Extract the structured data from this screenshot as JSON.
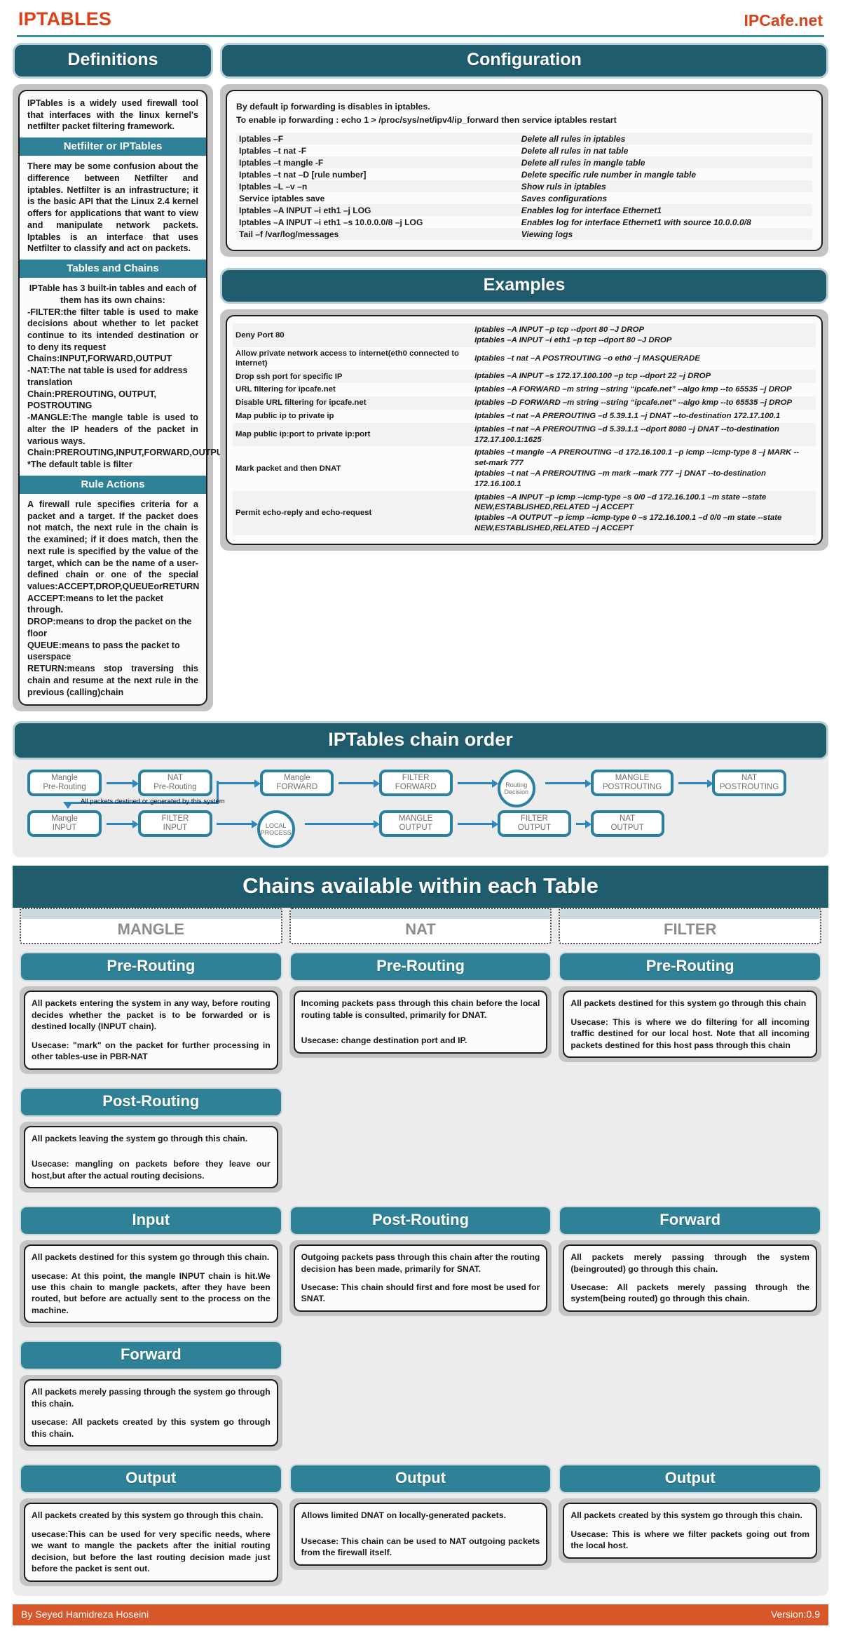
{
  "header": {
    "title": "IPTABLES",
    "site": "IPCafe.net"
  },
  "definitions": {
    "heading": "Definitions",
    "intro": "IPTables is a widely used firewall tool that interfaces with the linux kernel's netfilter packet filtering framework.",
    "netfilter_heading": "Netfilter or IPTables",
    "netfilter_body": "There may be some confusion about the difference between Netfilter and iptables. Netfilter is an infrastructure; it is the basic API that the Linux 2.4 kernel offers for applications that want to view and manipulate network packets. Iptables is an interface that uses Netfilter to classify and act on packets.",
    "tables_heading": "Tables and Chains",
    "tables_intro": "IPTable has 3 built-in tables and each of them has its own chains:",
    "tables_body": "-FILTER:the filter table is used to make decisions about whether to let packet continue to its intended destination or to deny its request",
    "filter_chains": " Chains:INPUT,FORWARD,OUTPUT",
    "nat_body": "-NAT:The nat table is used for address translation",
    "nat_chains": " Chain:PREROUTING, OUTPUT, POSTROUTING",
    "mangle_body": "-MANGLE:The mangle table is used to alter the IP headers of the  packet in various ways.",
    "mangle_chains": "Chain:PREROUTING,INPUT,FORWARD,OUTPUT,POSTROUTING",
    "default_note": "*The default table is filter",
    "rule_actions_heading": "Rule Actions",
    "rule_actions_body": "A firewall rule specifies criteria for a packet and a target. If the packet does not match, the next rule in the chain is the examined; if it does match, then the next rule is specified by the value of the target, which can be the name of a user-defined chain or one of the special values:ACCEPT,DROP,QUEUEorRETURN",
    "accept": "ACCEPT:means to let the packet through.",
    "drop": "DROP:means to drop the packet on the floor",
    "queue": "QUEUE:means to pass the packet to userspace",
    "return": "RETURN:means stop traversing this chain and resume at the next rule in the previous (calling)chain"
  },
  "configuration": {
    "heading": "Configuration",
    "intro_line1": "By default ip forwarding is disables in iptables.",
    "intro_line2": "To enable ip forwarding : echo 1 > /proc/sys/net/ipv4/ip_forward   then service iptables restart",
    "rows": [
      {
        "cmd": "Iptables –F",
        "desc": "Delete all rules in iptables"
      },
      {
        "cmd": "Iptables –t nat -F",
        "desc": "Delete all rules in nat table"
      },
      {
        "cmd": "Iptables –t mangle -F",
        "desc": "Delete all rules in mangle table"
      },
      {
        "cmd": "Iptables –t nat –D [rule number]",
        "desc": "Delete specific rule number in mangle table"
      },
      {
        "cmd": "Iptables –L –v –n",
        "desc": "Show ruls in iptables"
      },
      {
        "cmd": "Service iptables save",
        "desc": "Saves configurations"
      },
      {
        "cmd": "Iptables –A INPUT –i eth1 –j LOG",
        "desc": "Enables log for interface Ethernet1"
      },
      {
        "cmd": "Iptables –A INPUT –i eth1 –s 10.0.0.0/8 –j LOG",
        "desc": "Enables log for interface Ethernet1 with source 10.0.0.0/8"
      },
      {
        "cmd": "Tail –f /var/log/messages",
        "desc": "Viewing logs"
      }
    ]
  },
  "examples": {
    "heading": "Examples",
    "rows": [
      {
        "label": "Deny Port 80",
        "cmd": "Iptables –A INPUT –p tcp --dport 80 –J DROP\nIptables –A INPUT –i eth1 –p tcp --dport 80 –J DROP"
      },
      {
        "label": "Allow private network access to internet(eth0 connected to internet)",
        "cmd": "Iptables –t nat –A POSTROUTING –o eth0 –j MASQUERADE"
      },
      {
        "label": "Drop ssh port for specific IP",
        "cmd": "Iptables –A INPUT –s 172.17.100.100 –p tcp --dport 22 –j DROP"
      },
      {
        "label": "URL filtering for ipcafe.net",
        "cmd": "Iptables –A FORWARD –m string --string “ipcafe.net” --algo kmp --to 65535 –j DROP"
      },
      {
        "label": "Disable URL filtering for ipcafe.net",
        "cmd": "Iptables –D FORWARD –m string --string “ipcafe.net” --algo kmp --to 65535 –j DROP"
      },
      {
        "label": " Map public ip to private ip",
        "cmd": "Iptables –t nat –A PREROUTING –d 5.39.1.1 –j DNAT --to-destination 172.17.100.1"
      },
      {
        "label": "Map public ip:port to private ip:port",
        "cmd": "Iptables –t nat –A PREROUTING –d 5.39.1.1 --dport 8080 –j DNAT --to-destination 172.17.100.1:1625"
      },
      {
        "label": "Mark packet and then DNAT",
        "cmd": "Iptables –t mangle –A PREROUTING –d 172.16.100.1 –p icmp --icmp-type 8 –j MARK --set-mark 777\nIptables –t nat –A PREROUTING –m mark --mark 777 –j DNAT --to-destination 172.16.100.1"
      },
      {
        "label": "Permit echo-reply and echo-request",
        "cmd": "Iptables –A INPUT –p icmp --icmp-type –s 0/0 –d 172.16.100.1 –m state --state NEW,ESTABLISHED,RELATED –j ACCEPT\nIptables –A OUTPUT –p icmp --icmp-type 0 –s 172.16.100.1 –d 0/0 –m state --state NEW,ESTABLISHED,RELATED –j ACCEPT"
      }
    ]
  },
  "chain_order": {
    "title": "IPTables chain order",
    "nodes_top": [
      "Mangle\nPre-Routing",
      "NAT\nPre-Routing",
      "Mangle\nFORWARD",
      "FILTER\nFORWARD",
      "Routing\nDecision",
      "MANGLE\nPOSTROUTING",
      "NAT\nPOSTROUTING"
    ],
    "nodes_bottom": [
      "Mangle\nINPUT",
      "FILTER\nINPUT",
      "LOCAL\nPROCESS",
      "MANGLE\nOUTPUT",
      "FILTER\nOUTPUT",
      "NAT\nOUTPUT"
    ],
    "hook_label": "All packets destined or generated by this system"
  },
  "chains_available": {
    "title": "Chains available within each Table",
    "tables": [
      "MANGLE",
      "NAT",
      "FILTER"
    ],
    "mangle": {
      "prerouting_title": "Pre-Routing",
      "prerouting_body": "All packets entering the system in any way, before routing decides whether the packet is to be forwarded or is destined locally (INPUT chain).",
      "prerouting_usecase": "Usecase: \"mark\" on the packet for further processing in other tables-use in PBR-NAT",
      "postrouting_title": "Post-Routing",
      "postrouting_body": "All packets leaving the system go through this chain.",
      "postrouting_usecase": "Usecase: mangling on packets before they leave our host,but after the actual routing decisions.",
      "input_title": "Input",
      "input_body": "All packets destined for this system go through this chain.",
      "input_usecase": "usecase: At this point, the mangle INPUT chain is hit.We use this chain to mangle packets, after they have been routed, but before are actually sent to the process on the machine.",
      "forward_title": "Forward",
      "forward_body": "All packets merely passing through the system go through this chain.",
      "forward_usecase": "usecase: All packets created by this system go through this chain.",
      "output_title": "Output",
      "output_body": "All packets created by this system go through this chain.",
      "output_usecase": "usecase:This can be used for very specific needs, where we want to mangle the packets after the initial routing decision, but before the last routing decision made just before the packet is sent out."
    },
    "nat": {
      "prerouting_title": "Pre-Routing",
      "prerouting_body": "Incoming packets pass through this chain before the local routing table is consulted, primarily for DNAT.",
      "prerouting_usecase": "Usecase: change destination port and IP.",
      "postrouting_title": "Post-Routing",
      "postrouting_body": "Outgoing packets pass through this chain after the routing decision has been made, primarily for SNAT.",
      "postrouting_usecase": "Usecase: This chain should first and fore most be used for SNAT.",
      "output_title": "Output",
      "output_body": "Allows limited DNAT on locally-generated packets.",
      "output_usecase": "Usecase: This chain can be used to NAT outgoing packets from the firewall itself."
    },
    "filter": {
      "prerouting_title": "Pre-Routing",
      "prerouting_body": "All packets destined for this system go through this chain",
      "prerouting_usecase": "Usecase: This is where we do filtering for all incoming traffic destined for our local host. Note that all incoming packets destined for this host pass through this chain",
      "forward_title": "Forward",
      "forward_body": "All packets merely passing through the system (beingrouted) go through this chain.",
      "forward_usecase": "Usecase: All packets merely passing through the system(being routed) go through this chain.",
      "output_title": "Output",
      "output_body": "All packets created by this system go through this chain.",
      "output_usecase": "Usecase: This is where we filter packets going out from the local host."
    }
  },
  "footer": {
    "author": "By Seyed Hamidreza Hoseini",
    "version": "Version:0.9"
  }
}
